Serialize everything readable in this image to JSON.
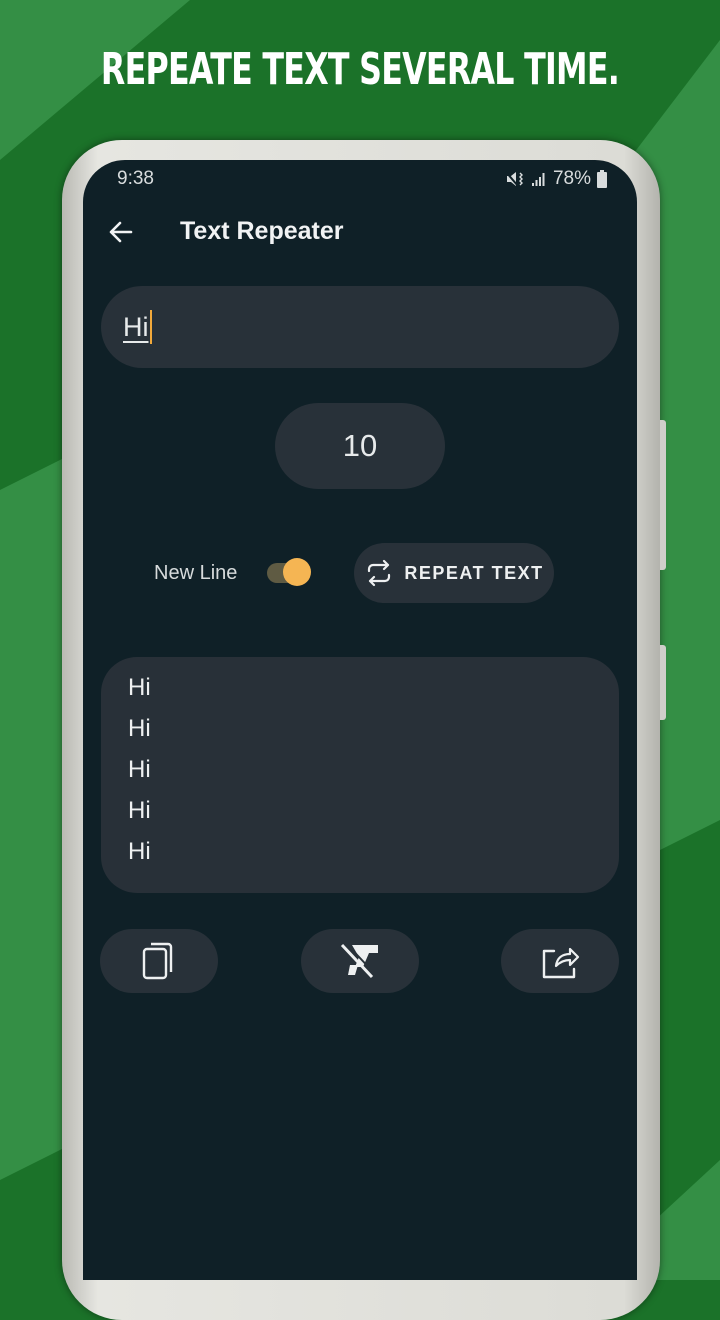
{
  "promo": {
    "headline": "REPEATE TEXT SEVERAL TIME."
  },
  "status_bar": {
    "time": "9:38",
    "icons": [
      "mute-vibrate-icon",
      "signal-icon",
      "battery-icon"
    ],
    "battery": "78%"
  },
  "appbar": {
    "title": "Text Repeater",
    "back_icon": "arrow-left-icon"
  },
  "input": {
    "value": "Hi",
    "placeholder": ""
  },
  "count": {
    "value": "10"
  },
  "controls": {
    "new_line_label": "New Line",
    "new_line_enabled": true,
    "repeat_label": "REPEAT TEXT",
    "repeat_icon": "repeat-icon"
  },
  "output": {
    "lines": [
      "Hi",
      "Hi",
      "Hi",
      "Hi",
      "Hi"
    ]
  },
  "actions": [
    {
      "name": "copy",
      "icon": "copy-icon"
    },
    {
      "name": "clear",
      "icon": "clear-format-icon"
    },
    {
      "name": "share",
      "icon": "share-icon"
    }
  ],
  "colors": {
    "background_green_dark": "#1b7229",
    "background_green_light": "#348f45",
    "screen_bg": "#0f2027",
    "surface": "#283139",
    "accent": "#f5b553"
  }
}
